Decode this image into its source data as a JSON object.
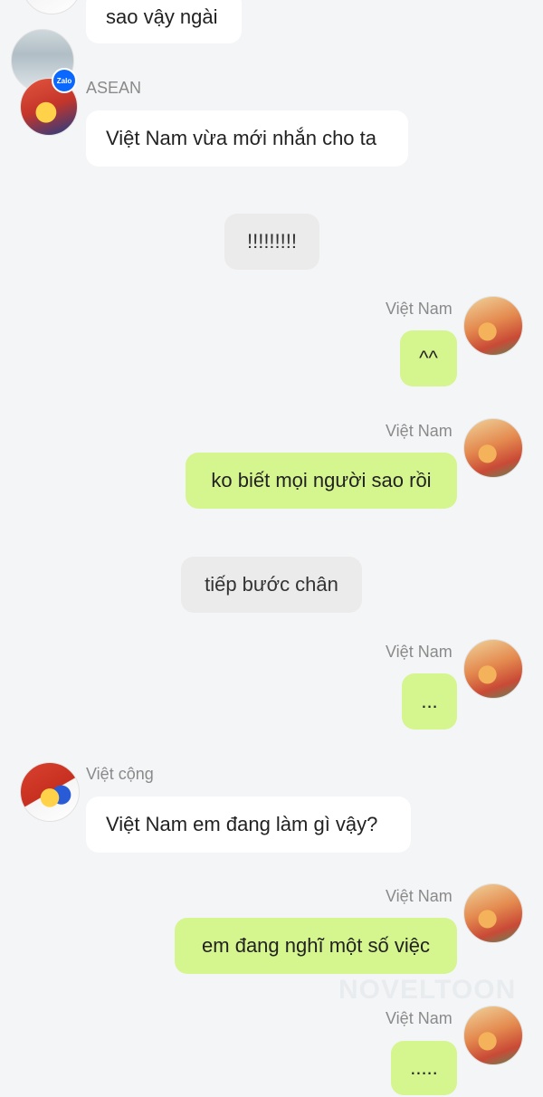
{
  "watermark": "NOVELTOON",
  "messages": [
    {
      "sender": "",
      "text": "sao vậy ngài"
    },
    {
      "sender": "ASEAN",
      "text": "Việt Nam vừa mới nhắn cho ta"
    },
    {
      "sender": "",
      "text": "!!!!!!!!!"
    },
    {
      "sender": "Việt Nam",
      "text": "^^"
    },
    {
      "sender": "Việt Nam",
      "text": "ko biết mọi người sao rồi"
    },
    {
      "sender": "",
      "text": "tiếp bước chân"
    },
    {
      "sender": "Việt Nam",
      "text": "..."
    },
    {
      "sender": "Việt cộng",
      "text": "Việt Nam em đang làm gì vậy?"
    },
    {
      "sender": "Việt Nam",
      "text": "em đang nghĩ một số việc"
    },
    {
      "sender": "Việt Nam",
      "text": "....."
    }
  ],
  "badges": {
    "zalo": "Zalo"
  },
  "icons": {
    "avatar_vietnam": "avatar-vietnam-icon",
    "avatar_vietcong": "avatar-vietcong-icon",
    "zalo": "zalo-badge-icon"
  },
  "colors": {
    "background": "#f4f5f7",
    "sent_bubble": "#d5f58f",
    "received_bubble": "#ffffff",
    "system_bubble": "#ebebec"
  }
}
